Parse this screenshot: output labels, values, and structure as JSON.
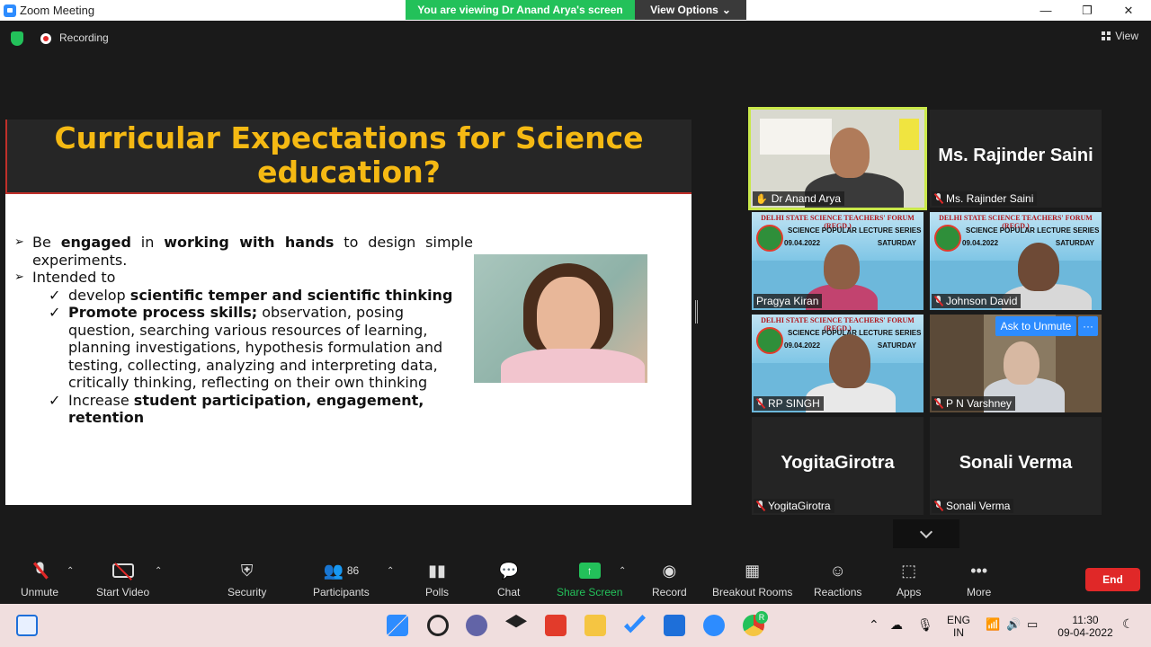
{
  "window": {
    "title": "Zoom Meeting",
    "viewing_banner": "You are viewing Dr Anand Arya's screen",
    "view_options": "View Options",
    "minimize": "—",
    "maximize": "❐",
    "close": "✕"
  },
  "topbar": {
    "recording_label": "Recording",
    "view_label": "View"
  },
  "slide": {
    "title": "Curricular Expectations for Science education?",
    "bullets": [
      {
        "parts": [
          "Be ",
          "engaged",
          " in ",
          "working with hands",
          " to design simple experiments."
        ]
      },
      {
        "parts": [
          "Intended to"
        ]
      }
    ],
    "sub": [
      {
        "plain": "develop ",
        "bold": "scientific temper and scientific thinking",
        "rest": ""
      },
      {
        "plain": "",
        "bold": "Promote process skills;",
        "rest": " observation, posing question, searching various resources of learning, planning investigations, hypothesis formulation and testing, collecting, analyzing and interpreting data, critically thinking, reflecting on their own thinking"
      },
      {
        "plain": "Increase ",
        "bold": "student participation, engagement, retention",
        "rest": ""
      }
    ]
  },
  "banner": {
    "org": "DELHI STATE SCIENCE TEACHERS' FORUM (REGD.)",
    "series": "SCIENCE POPULAR LECTURE SERIES",
    "date": "09.04.2022",
    "day": "SATURDAY"
  },
  "participants": [
    {
      "name": "Dr Anand Arya",
      "big": ""
    },
    {
      "name": "Ms. Rajinder Saini",
      "big": "Ms. Rajinder Saini"
    },
    {
      "name": "Pragya Kiran",
      "big": ""
    },
    {
      "name": "Johnson David",
      "big": ""
    },
    {
      "name": "RP SINGH",
      "big": ""
    },
    {
      "name": "P N Varshney",
      "big": ""
    },
    {
      "name": "YogitaGirotra",
      "big": "YogitaGirotra"
    },
    {
      "name": "Sonali Verma",
      "big": "Sonali Verma"
    }
  ],
  "ask_unmute": "Ask to Unmute",
  "more_dots": "···",
  "toolbar": {
    "unmute": "Unmute",
    "start_video": "Start Video",
    "security": "Security",
    "participants": "Participants",
    "participant_count": "86",
    "polls": "Polls",
    "chat": "Chat",
    "share_screen": "Share Screen",
    "record": "Record",
    "breakout_rooms": "Breakout Rooms",
    "reactions": "Reactions",
    "apps": "Apps",
    "more": "More",
    "end": "End"
  },
  "taskbar": {
    "lang_top": "ENG",
    "lang_bottom": "IN",
    "time": "11:30",
    "date": "09-04-2022",
    "chrome_badge": "R"
  },
  "colors": {
    "green": "#23c15a",
    "zoom_blue": "#2d8cff",
    "end_red": "#e02828",
    "slide_title": "#f5b913"
  }
}
